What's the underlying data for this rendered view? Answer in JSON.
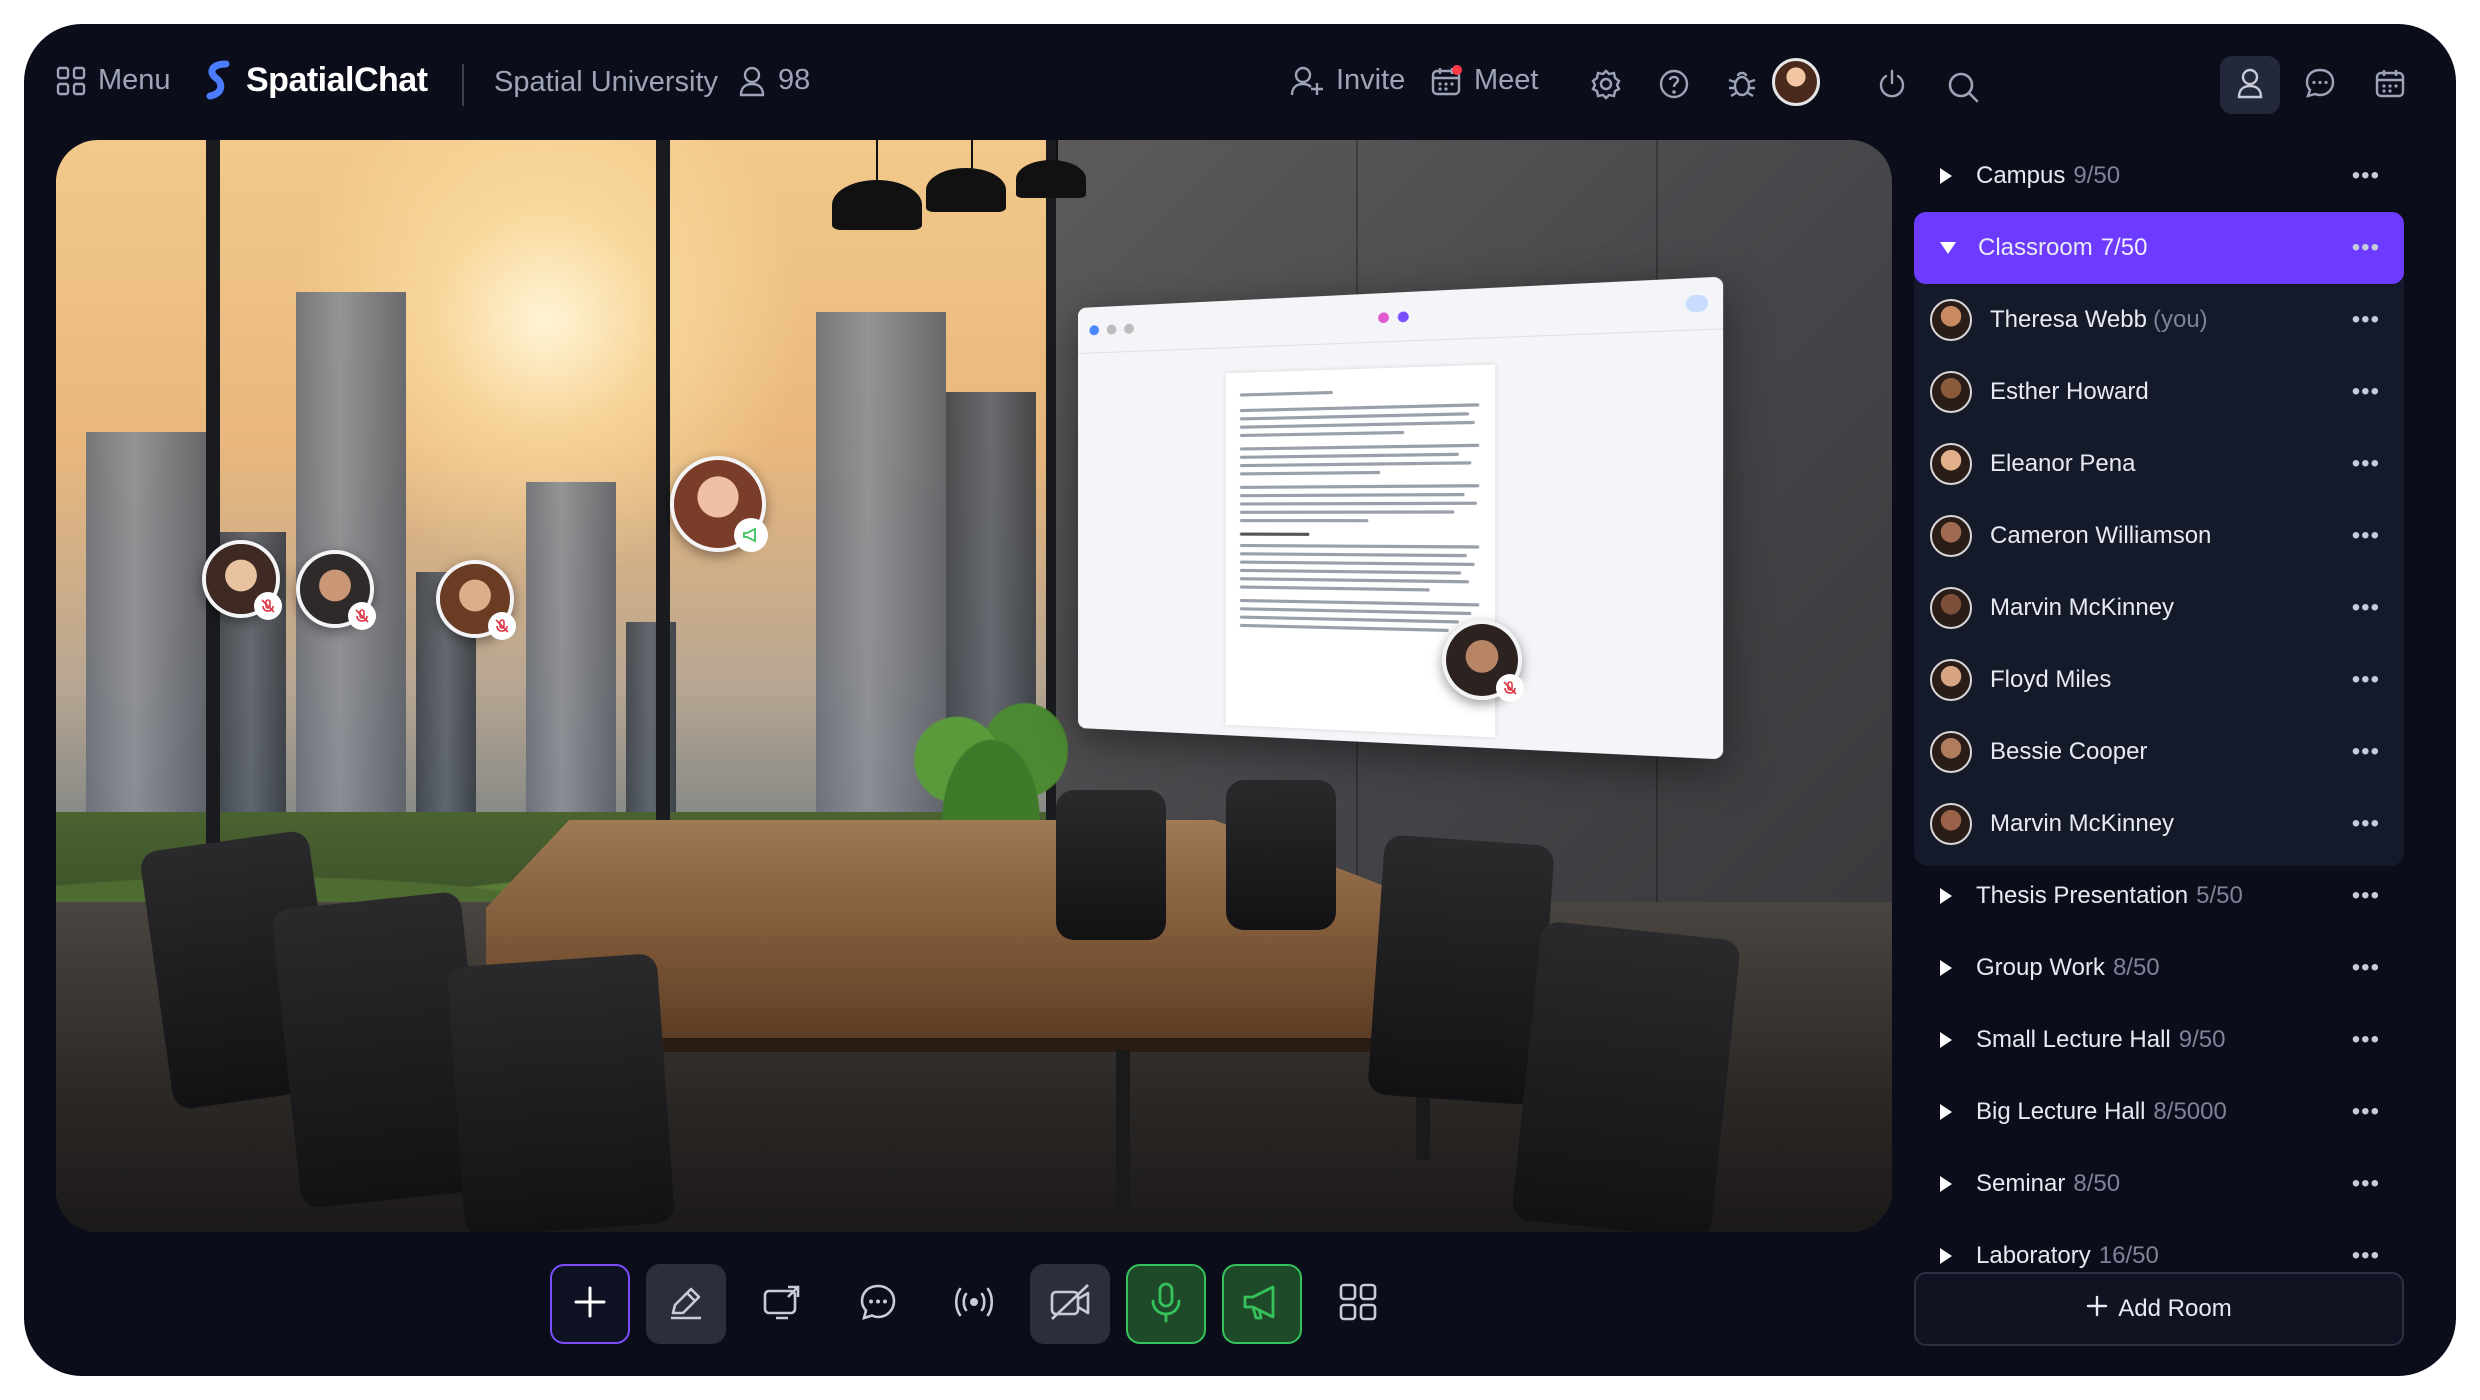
{
  "topbar": {
    "menu_label": "Menu",
    "app_name": "SpatialChat",
    "space_name": "Spatial University",
    "participant_count": "98",
    "invite_label": "Invite",
    "meet_label": "Meet",
    "icons": [
      "grid-icon",
      "logo-icon",
      "users-icon",
      "add-user-icon",
      "calendar-icon",
      "gear-icon",
      "help-icon",
      "bug-icon",
      "power-icon",
      "search-icon",
      "person-icon",
      "chat-icon",
      "calendar-icon"
    ]
  },
  "sidebar": {
    "rooms_top": [
      {
        "name": "Campus",
        "count": "9/50"
      }
    ],
    "active_room": {
      "name": "Classroom",
      "count": "7/50"
    },
    "people": [
      {
        "name": "Theresa Webb",
        "suffix": "(you)",
        "color": "#c98a62"
      },
      {
        "name": "Esther Howard",
        "suffix": "",
        "color": "#8a5a3c"
      },
      {
        "name": "Eleanor Pena",
        "suffix": "",
        "color": "#e1b08a"
      },
      {
        "name": "Cameron Williamson",
        "suffix": "",
        "color": "#a06b52"
      },
      {
        "name": "Marvin McKinney",
        "suffix": "",
        "color": "#7b4f3a"
      },
      {
        "name": "Floyd Miles",
        "suffix": "",
        "color": "#d8a582"
      },
      {
        "name": "Bessie Cooper",
        "suffix": "",
        "color": "#b07c5e"
      },
      {
        "name": "Marvin McKinney",
        "suffix": "",
        "color": "#9a6248"
      }
    ],
    "rooms_bottom": [
      {
        "name": "Thesis Presentation",
        "count": "5/50"
      },
      {
        "name": "Group Work",
        "count": "8/50"
      },
      {
        "name": "Small Lecture Hall",
        "count": "9/50"
      },
      {
        "name": "Big Lecture Hall",
        "count": "8/5000"
      },
      {
        "name": "Seminar",
        "count": "8/50"
      },
      {
        "name": "Laboratory",
        "count": "16/50"
      }
    ],
    "more_glyph": "•••",
    "add_room_label": "Add Room"
  },
  "toolbar": {
    "buttons": [
      "add-icon",
      "pencil-icon",
      "screen-share-icon",
      "chat-bubble-icon",
      "broadcast-icon",
      "camera-off-icon",
      "microphone-icon",
      "megaphone-icon",
      "apps-grid-icon"
    ]
  },
  "colors": {
    "accent": "#6c3bff",
    "background": "#0b0e1a",
    "active_green": "#36c25a",
    "muted": "#7d8398"
  }
}
